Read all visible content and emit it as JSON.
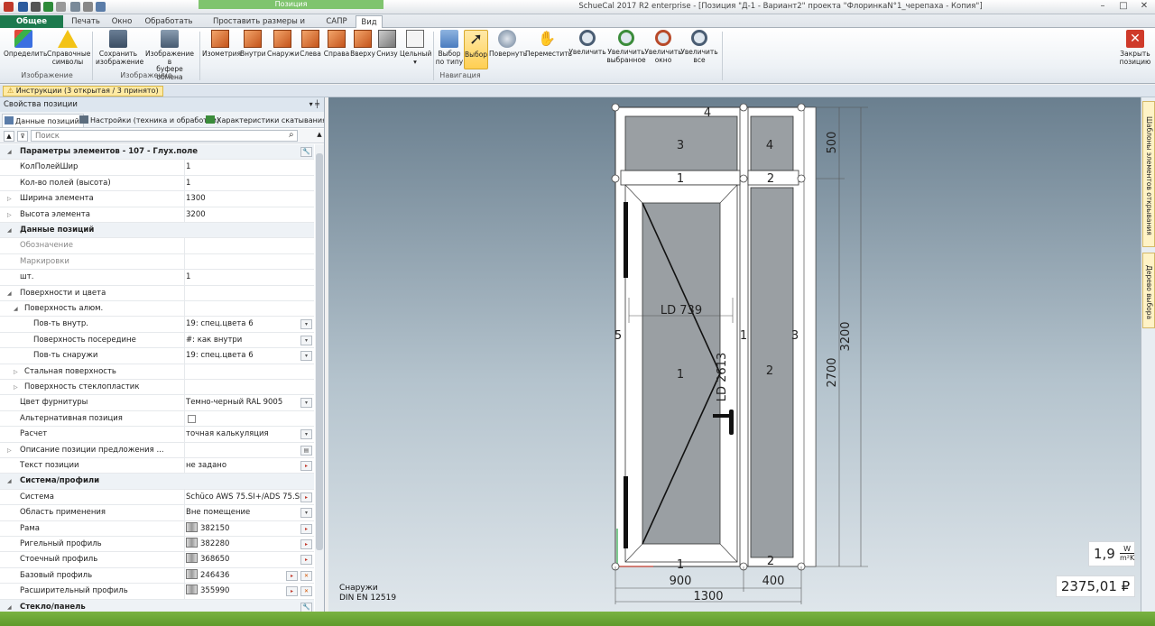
{
  "window": {
    "title": "SchueCal 2017 R2 enterprise - [Позиция \"Д-1 - Вариант2\" проекта \"ФлоринкаN°1_черепаха - Копия\"]",
    "context_tab_header": "Позиция"
  },
  "tabs": [
    "Общее",
    "Печать",
    "Окно",
    "Обработать",
    "Проставить размеры и надписи",
    "САПР",
    "Вид"
  ],
  "ribbon": {
    "buttons": {
      "opredelit": "Определить",
      "sprav1": "Справочные",
      "sprav2": "символы",
      "save1": "Сохранить",
      "save2": "изображение",
      "buf1": "Изображение в",
      "buf2": "буфере обмена",
      "iso": "Изометрия",
      "inside": "Внутри",
      "outside": "Снаружи",
      "left": "Слева",
      "right": "Справа",
      "top": "Вверху",
      "bottom": "Снизу",
      "whole": "Цельный",
      "bytype1": "Выбор",
      "bytype2": "по типу",
      "select": "Выбор",
      "rotate": "Повернуть",
      "move": "Переместить",
      "zoom": "Увеличить",
      "zoomsel1": "Увеличить",
      "zoomsel2": "выбранное",
      "zoomwin1": "Увеличить",
      "zoomwin2": "окно",
      "zoomall1": "Увеличить",
      "zoomall2": "все",
      "close1": "Закрыть",
      "close2": "позицию"
    },
    "groups": {
      "image1": "Изображение",
      "image2": "Изображение",
      "navigation": "Навигация"
    }
  },
  "instructions": "Инструкции (3 открытая / 3 принято)",
  "panel": {
    "title": "Свойства позиции",
    "tabs": [
      "Данные позиций",
      "Настройки (техника и обработки)",
      "Характеристики скатывания"
    ],
    "search_placeholder": "Поиск"
  },
  "properties": [
    {
      "label": "Параметры элементов - 107 - Глух.поле",
      "cat": true,
      "wrench": true
    },
    {
      "label": "КолПолейШир",
      "value": "1"
    },
    {
      "label": "Кол-во полей (высота)",
      "value": "1"
    },
    {
      "label": "Ширина элемента",
      "value": "1300",
      "exp": true
    },
    {
      "label": "Высота элемента",
      "value": "3200",
      "exp": true
    },
    {
      "label": "Данные позиций",
      "cat": true
    },
    {
      "label": "Обозначение",
      "value": "",
      "grey": true
    },
    {
      "label": "Маркировки",
      "value": "",
      "grey": true
    },
    {
      "label": "шт.",
      "value": "1"
    },
    {
      "label": "Поверхности и цвета",
      "value": "",
      "caret": true
    },
    {
      "label": "Поверхность алюм.",
      "value": "",
      "caret": true,
      "level": 1
    },
    {
      "label": "Пов-ть внутр.",
      "value": "19: спец.цвета 6",
      "level": 2,
      "btn": "dd"
    },
    {
      "label": "Поверхность посередине",
      "value": "#: как внутри",
      "level": 2,
      "btn": "dd"
    },
    {
      "label": "Пов-ть снаружи",
      "value": "19: спец.цвета 6",
      "level": 2,
      "btn": "dd"
    },
    {
      "label": "Стальная поверхность",
      "value": "",
      "exp": true,
      "level": 1
    },
    {
      "label": "Поверхность стеклопластик",
      "value": "",
      "exp": true,
      "level": 1
    },
    {
      "label": "Цвет фурнитуры",
      "value": "Темно-черный RAL 9005",
      "btn": "dd"
    },
    {
      "label": "Альтернативная позиция",
      "value": "",
      "checkbox": true
    },
    {
      "label": "Расчет",
      "value": "точная калькуляция",
      "btn": "dd"
    },
    {
      "label": "Описание позиции предложения ...",
      "value": "",
      "exp": true,
      "btn": "dots"
    },
    {
      "label": "Текст позиции",
      "value": "не задано",
      "btn": "arrow"
    },
    {
      "label": "Система/профили",
      "cat": true
    },
    {
      "label": "Система",
      "value": "Schüco AWS 75.SI+/ADS 75.SI",
      "btn": "arrow"
    },
    {
      "label": "Область применения",
      "value": "Вне помещение",
      "btn": "dd"
    },
    {
      "label": "Рама",
      "value": "382150",
      "icon": true,
      "btn": "arrow"
    },
    {
      "label": "Ригельный профиль",
      "value": "382280",
      "icon": true,
      "btn": "arrow"
    },
    {
      "label": "Стоечный профиль",
      "value": "368650",
      "icon": true,
      "btn": "arrow"
    },
    {
      "label": "Базовый профиль",
      "value": "246436",
      "icon": true,
      "btn": "arrowx"
    },
    {
      "label": "Расширительный профиль",
      "value": "355990",
      "icon": true,
      "btn": "arrowx"
    },
    {
      "label": "Стекло/панель",
      "cat": true,
      "wrench": true
    }
  ],
  "drawing": {
    "dims": {
      "w_left": "900",
      "w_right": "400",
      "w_total": "1300",
      "h_top": "500",
      "h_lower": "2700",
      "h_total": "3200"
    },
    "labels": {
      "top_frame": "4",
      "left_frame": "5",
      "right_frame": "3",
      "mullion": "1",
      "transom_left": "1",
      "transom_right": "2",
      "bottom_left": "1",
      "bottom_right": "2",
      "fill_top_left": "3",
      "fill_top_right": "4",
      "fill_door": "1",
      "fill_side": "2",
      "ld_w": "LD 739",
      "ld_h": "LD 2613"
    },
    "view_note": "Снаружи",
    "standard": "DIN EN 12519"
  },
  "u_value": "1,9",
  "u_unit_num": "W",
  "u_unit_den": "m²K",
  "price": "2375,01 ₽",
  "side_tabs": [
    "Шаблоны элементов открывания",
    "Дерево выбора"
  ]
}
